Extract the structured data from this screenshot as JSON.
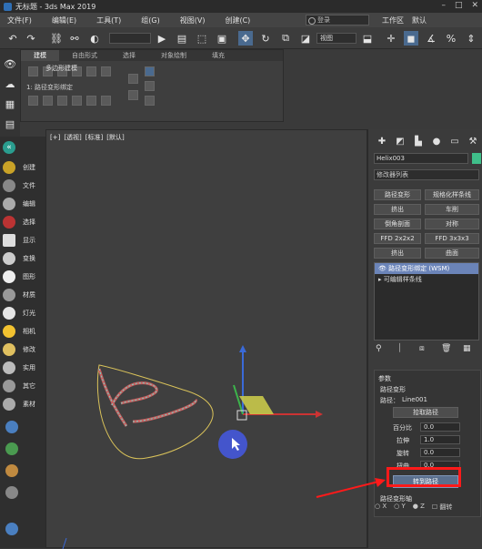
{
  "title": "无标题 - 3ds Max 2019",
  "menu": [
    "文件(F)",
    "编辑(E)",
    "工具(T)",
    "组(G)",
    "视图(V)",
    "创建(C)"
  ],
  "search_placeholder": "登录",
  "workspace_label": "工作区",
  "workspace_value": "默认",
  "toolbar": {
    "view_dropdown": "视图"
  },
  "ribbon": {
    "tabs": [
      "建模",
      "自由形式",
      "选择",
      "对象绘制",
      "填充"
    ],
    "title": "多边形建模",
    "label": "1: 路径变形绑定"
  },
  "command_panel": [
    "创建",
    "文件",
    "编辑",
    "选择",
    "显示",
    "变换",
    "图形",
    "材质",
    "灯光",
    "相机",
    "修改",
    "实用",
    "其它",
    "素材"
  ],
  "viewport": {
    "labels": [
      "[+]",
      "[透视]",
      "[标准]",
      "[默认]"
    ]
  },
  "right_panel": {
    "object_name": "Helix003",
    "object_color": "#3fbf8a",
    "modifier_list": "修改器列表",
    "mod_buttons": [
      "路径变形",
      "规格化样条线",
      "挤出",
      "车削",
      "倒角剖面",
      "对称",
      "FFD 2x2x2",
      "FFD 3x3x3",
      "挤出",
      "曲面"
    ],
    "stack": [
      "路径变形绑定 (WSM)",
      "可编辑样条线"
    ],
    "params": {
      "rollout_title": "参数",
      "section_title": "路径变形",
      "path_label": "路径：",
      "path_value": "Line001",
      "pick_path": "拾取路径",
      "percent_label": "百分比",
      "percent_value": "0.0",
      "stretch_label": "拉伸",
      "stretch_value": "1.0",
      "rotation_label": "旋转",
      "rotation_value": "0.0",
      "twist_label": "扭曲",
      "twist_value": "0.0",
      "move_to_path": "转到路径",
      "axis_title": "路径变形轴",
      "axis_options": [
        "X",
        "Y",
        "Z"
      ],
      "flip_label": "翻转"
    }
  }
}
